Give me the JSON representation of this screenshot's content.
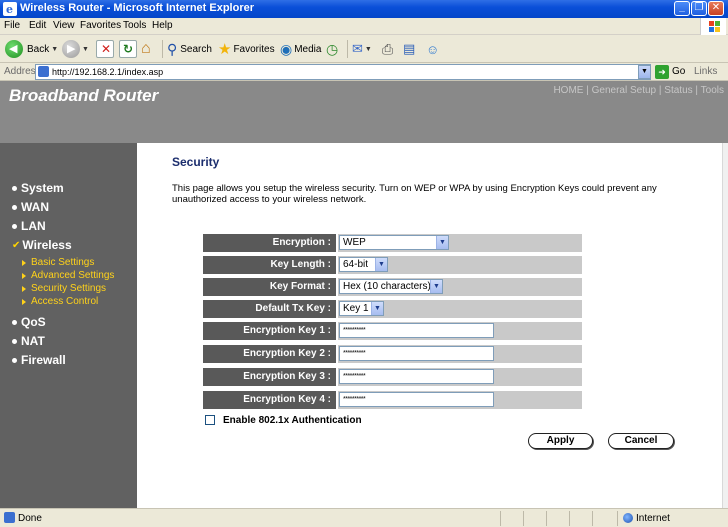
{
  "window": {
    "title": "Wireless Router - Microsoft Internet Explorer"
  },
  "menu": [
    "File",
    "Edit",
    "View",
    "Favorites",
    "Tools",
    "Help"
  ],
  "toolbar": {
    "back_label": "Back",
    "search_label": "Search",
    "favorites_label": "Favorites",
    "media_label": "Media"
  },
  "address": {
    "label": "Address",
    "url": "http://192.168.2.1/index.asp",
    "go_label": "Go",
    "links_label": "Links"
  },
  "header": {
    "brand": "Broadband Router",
    "nav": [
      "HOME",
      "General Setup",
      "Status",
      "Tools"
    ],
    "nav_sep": "|"
  },
  "sidebar": {
    "items": [
      {
        "label": "System"
      },
      {
        "label": "WAN"
      },
      {
        "label": "LAN"
      },
      {
        "label": "Wireless",
        "active": true
      },
      {
        "label": "QoS"
      },
      {
        "label": "NAT"
      },
      {
        "label": "Firewall"
      }
    ],
    "wireless_sub": [
      "Basic Settings",
      "Advanced Settings",
      "Security Settings",
      "Access Control"
    ]
  },
  "main": {
    "title": "Security",
    "description": "This page allows you setup the wireless security. Turn on WEP or WPA by using Encryption Keys could prevent any unauthorized access to your wireless network.",
    "fields": [
      {
        "label": "Encryption :",
        "value": "WEP"
      },
      {
        "label": "Key Length :",
        "value": "64-bit"
      },
      {
        "label": "Key Format :",
        "value": "Hex (10 characters)"
      },
      {
        "label": "Default Tx Key :",
        "value": "Key 1"
      },
      {
        "label": "Encryption Key 1 :",
        "value": "**********"
      },
      {
        "label": "Encryption Key 2 :",
        "value": "**********"
      },
      {
        "label": "Encryption Key 3 :",
        "value": "**********"
      },
      {
        "label": "Encryption Key 4 :",
        "value": "**********"
      }
    ],
    "enable_8021x_label": "Enable 802.1x Authentication",
    "apply_label": "Apply",
    "cancel_label": "Cancel"
  },
  "status": {
    "text": "Done",
    "zone": "Internet"
  },
  "colors": {
    "header_bg": "#898989",
    "sidebar_bg": "#616161",
    "label_bg": "#595959",
    "value_bg": "#c9c9c9",
    "submenu_text": "#ffd21a",
    "title_text": "#1c2e6e"
  }
}
